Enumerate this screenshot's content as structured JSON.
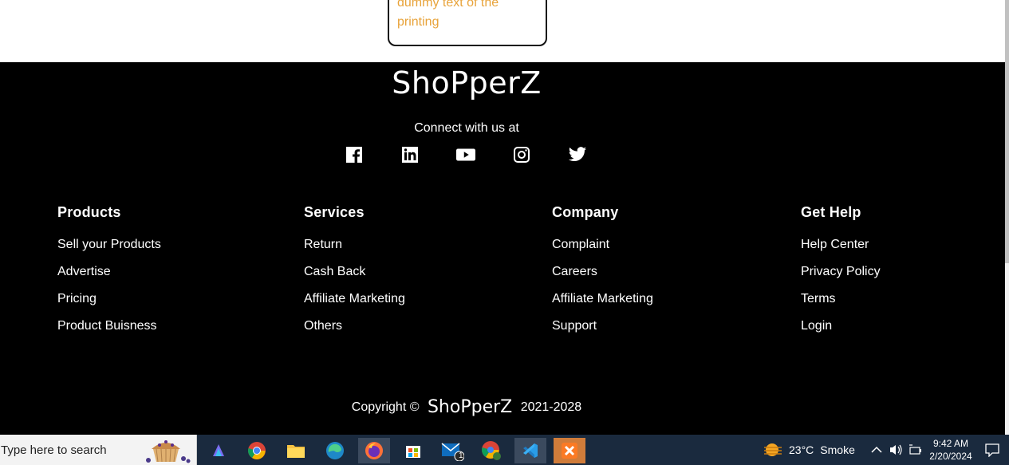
{
  "card": {
    "line1": "dummy text of the",
    "line2": "printing"
  },
  "footer": {
    "brand": "ShoPperZ",
    "connect": "Connect with us at",
    "socials": [
      "facebook-icon",
      "linkedin-icon",
      "youtube-icon",
      "instagram-icon",
      "twitter-icon"
    ],
    "columns": [
      {
        "title": "Products",
        "links": [
          "Sell your Products",
          "Advertise",
          "Pricing",
          "Product Buisness"
        ]
      },
      {
        "title": "Services",
        "links": [
          "Return",
          "Cash Back",
          "Affiliate Marketing",
          "Others"
        ]
      },
      {
        "title": "Company",
        "links": [
          "Complaint",
          "Careers",
          "Affiliate Marketing",
          "Support"
        ]
      },
      {
        "title": "Get Help",
        "links": [
          "Help Center",
          "Privacy Policy",
          "Terms",
          "Login"
        ]
      }
    ],
    "copyright": {
      "prefix": "Copyright ©",
      "brand": "ShoPperZ",
      "years": "2021-2028"
    }
  },
  "taskbar": {
    "search_placeholder": "Type here to search",
    "mail_badge": "1",
    "weather": {
      "temp": "23°C",
      "condition": "Smoke"
    },
    "time": "9:42 AM",
    "date": "2/20/2024"
  },
  "colors": {
    "card_text": "#e8a33a",
    "footer_bg": "#000000",
    "taskbar_bg": "#1a2a3e"
  }
}
